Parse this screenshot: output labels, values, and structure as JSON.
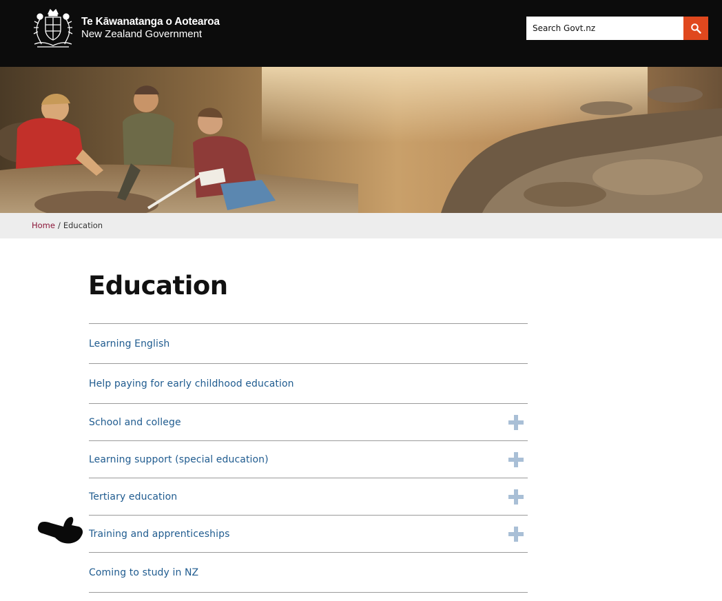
{
  "header": {
    "logo_title": "Te Kāwanatanga o Aotearoa",
    "logo_subtitle": "New Zealand Government",
    "crest_icon": "nz-coat-of-arms-icon",
    "search_placeholder": "Search Govt.nz",
    "search_icon": "search-icon",
    "accent_color": "#e0481e"
  },
  "hero": {
    "alt": "Students studying on a rocky shoreline"
  },
  "breadcrumb": {
    "home_label": "Home",
    "separator": "/",
    "current_label": "Education"
  },
  "page": {
    "title": "Education"
  },
  "menu": {
    "items": [
      {
        "label": "Learning English",
        "expandable": false
      },
      {
        "label": "Help paying for early childhood education",
        "expandable": false
      },
      {
        "label": "School and college",
        "expandable": true
      },
      {
        "label": "Learning support (special education)",
        "expandable": true
      },
      {
        "label": "Tertiary education",
        "expandable": true
      },
      {
        "label": "Training and apprenticeships",
        "expandable": true
      },
      {
        "label": "Coming to study in NZ",
        "expandable": false
      }
    ],
    "link_color": "#1f5b8f",
    "expand_icon": "plus-icon"
  },
  "annotation": {
    "icon": "pointing-hand-icon"
  }
}
